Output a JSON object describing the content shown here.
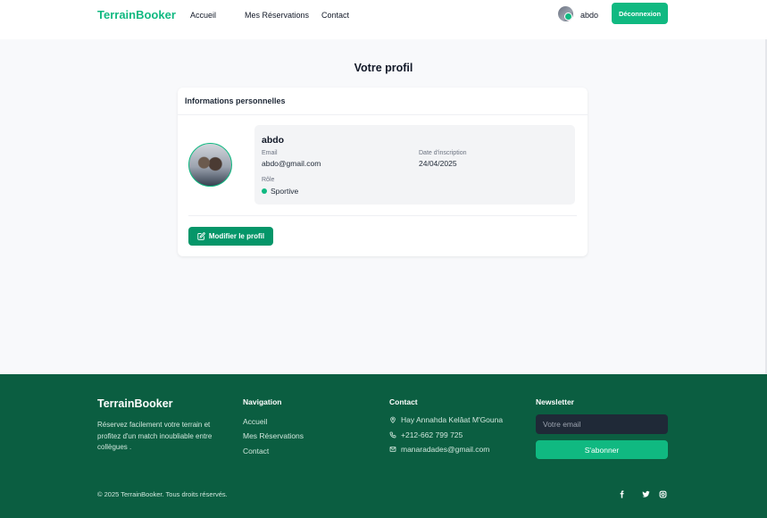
{
  "nav": {
    "brand": "TerrainBooker",
    "links": [
      "Accueil",
      "Mes Réservations",
      "Contact"
    ],
    "user_name": "abdo",
    "logout_label": "Déconnexion"
  },
  "page": {
    "title": "Votre profil"
  },
  "card": {
    "header": "Informations personnelles",
    "name": "abdo",
    "email_label": "Email",
    "email": "abdo@gmail.com",
    "date_label": "Date d'inscription",
    "date": "24/04/2025",
    "role_label": "Rôle",
    "role": "Sportive",
    "edit_label": "Modifier le profil"
  },
  "footer": {
    "brand": "TerrainBooker",
    "description": "Réservez facilement votre terrain et profitez d'un match inoubliable entre collègues .",
    "nav_heading": "Navigation",
    "nav_links": [
      "Accueil",
      "Mes Réservations",
      "Contact"
    ],
    "contact_heading": "Contact",
    "address": "Hay Annahda Kelâat M'Gouna",
    "phone": "+212-662 799 725",
    "email": "manaradades@gmail.com",
    "newsletter_heading": "Newsletter",
    "newsletter_placeholder": "Votre email",
    "subscribe_label": "S'abonner",
    "copyright": "© 2025 TerrainBooker. Tous droits réservés.",
    "socials": [
      "facebook-icon",
      "twitter-icon",
      "instagram-icon"
    ]
  },
  "colors": {
    "accent": "#10b981",
    "footer_bg": "#0b5e41",
    "button_dark": "#059669"
  }
}
